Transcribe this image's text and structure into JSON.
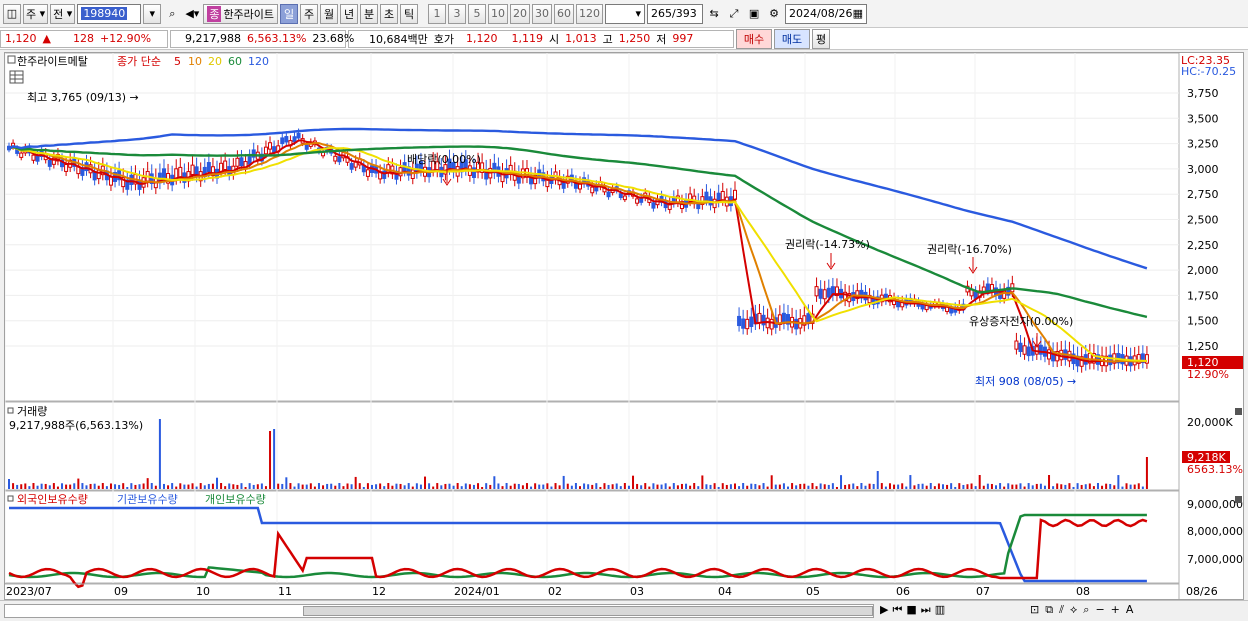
{
  "toolbar": {
    "period_select": "주",
    "prev_label": "전",
    "code": "198940",
    "name_badge": "종",
    "name": "한주라이트",
    "periods": [
      "일",
      "주",
      "월",
      "년",
      "분",
      "초",
      "틱"
    ],
    "intervals": [
      "1",
      "3",
      "5",
      "10",
      "20",
      "30",
      "60",
      "120"
    ],
    "count": "265",
    "total": "/393",
    "date": "2024/08/26"
  },
  "quote": {
    "price": "1,120",
    "arrow": "▲",
    "change": "128",
    "change_pct": "+12.90%",
    "volume": "9,217,988",
    "vol_ratio": "6,563.13%",
    "turnover": "23.68%",
    "amount": "10,684백만",
    "bid_label": "호가",
    "ask_price": "1,120",
    "bid_price": "1,119",
    "open_label": "시",
    "open": "1,013",
    "high_label": "고",
    "high": "1,250",
    "low_label": "저",
    "low": "997",
    "buy_label": "매수",
    "sell_label": "매도",
    "eval_label": "평"
  },
  "price_panel": {
    "title": "한주라이트메탈",
    "legend_prefix": "종가 단순",
    "ma_labels": [
      "5",
      "10",
      "20",
      "60",
      "120"
    ],
    "ma_colors": [
      "#d40000",
      "#e08000",
      "#f0e000",
      "#1a8a3a",
      "#2a5adf"
    ],
    "lc": "LC:23.35",
    "hc": "HC:-70.25",
    "y_ticks": [
      "3,750",
      "3,500",
      "3,250",
      "3,000",
      "2,750",
      "2,500",
      "2,250",
      "2,000",
      "1,750",
      "1,500",
      "1,250"
    ],
    "cur_price": "1,120",
    "cur_pct": "12.90%",
    "annotations": {
      "high": "최고 3,765 (09/13) →",
      "div": "배당락(0.00%)",
      "right1": "권리락(-14.73%)",
      "right2": "권리락(-16.70%)",
      "capital": "유상증자전자(0.00%)",
      "low": "최저 908 (08/05) →"
    }
  },
  "volume_panel": {
    "title": "거래량",
    "value": "9,217,988주(6,563.13%)",
    "y_tick": "20,000K",
    "cur_vol": "9,218K",
    "cur_pct": "6563.13%"
  },
  "holder_panel": {
    "legend": [
      "외국인보유수량",
      "기관보유수량",
      "개인보유수량"
    ],
    "y_ticks": [
      "9,000,000",
      "8,000,000",
      "7,000,000"
    ]
  },
  "x_axis": [
    "2023/07",
    "09",
    "10",
    "11",
    "12",
    "2024/01",
    "02",
    "03",
    "04",
    "05",
    "06",
    "07",
    "08",
    "08/26"
  ],
  "chart_data": [
    {
      "type": "line",
      "title": "한주라이트메탈",
      "series": [
        {
          "name": "5",
          "color": "#d40000"
        },
        {
          "name": "10",
          "color": "#e08000"
        },
        {
          "name": "20",
          "color": "#f0e000"
        },
        {
          "name": "60",
          "color": "#1a8a3a"
        },
        {
          "name": "120",
          "color": "#2a5adf"
        }
      ],
      "ylabel": "",
      "ylim": [
        1100,
        3850
      ]
    },
    {
      "type": "bar",
      "title": "거래량"
    },
    {
      "type": "line",
      "title": "",
      "series": [
        {
          "name": "외국인보유수량",
          "color": "#d40000"
        },
        {
          "name": "기관보유수량",
          "color": "#2a5adf"
        },
        {
          "name": "개인보유수량",
          "color": "#1a8a3a"
        }
      ],
      "ylim": [
        6300000,
        9200000
      ]
    }
  ]
}
